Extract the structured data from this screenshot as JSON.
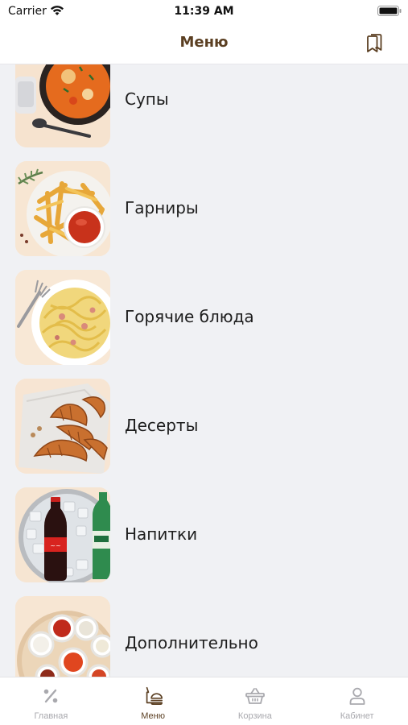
{
  "status_bar": {
    "carrier": "Carrier",
    "time": "11:39 AM"
  },
  "nav": {
    "title": "Меню",
    "bookmark_icon": "bookmark-icon"
  },
  "categories": [
    {
      "label": "Супы",
      "icon": "soup-photo"
    },
    {
      "label": "Гарниры",
      "icon": "fries-photo"
    },
    {
      "label": "Горячие блюда",
      "icon": "pasta-photo"
    },
    {
      "label": "Десерты",
      "icon": "croissant-photo"
    },
    {
      "label": "Напитки",
      "icon": "drinks-photo"
    },
    {
      "label": "Дополнительно",
      "icon": "sauces-photo"
    }
  ],
  "tabs": [
    {
      "label": "Главная",
      "icon": "percent-icon",
      "active": false
    },
    {
      "label": "Меню",
      "icon": "menu-food-icon",
      "active": true
    },
    {
      "label": "Корзина",
      "icon": "basket-icon",
      "active": false
    },
    {
      "label": "Кабинет",
      "icon": "user-icon",
      "active": false
    }
  ],
  "colors": {
    "accent": "#5b3f22",
    "inactive": "#a9a9ae",
    "background": "#f0f1f4",
    "thumb_bg": "#f8e9d8"
  }
}
